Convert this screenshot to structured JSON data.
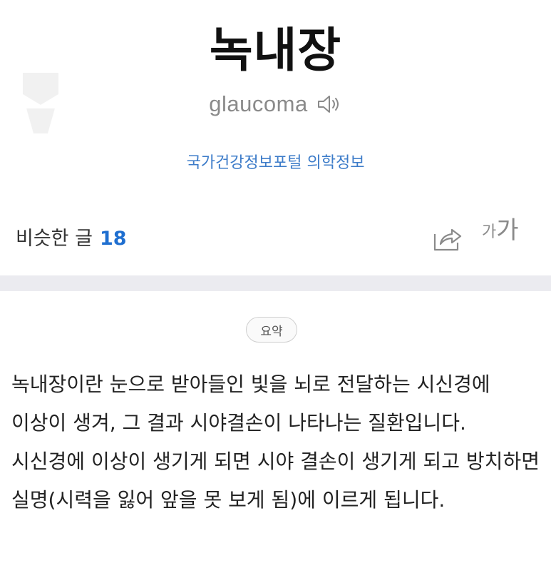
{
  "entry": {
    "title": "녹내장",
    "pronunciation": "glaucoma",
    "source": "국가건강정보포털 의학정보"
  },
  "toolbar": {
    "similar_label": "비슷한 글",
    "similar_count": "18",
    "font_small": "가",
    "font_large": "가"
  },
  "summary": {
    "badge": "요약",
    "text": "녹내장이란 눈으로 받아들인 빛을 뇌로 전달하는 시신경에 이상이 생겨, 그 결과 시야결손이 나타나는 질환입니다. 시신경에 이상이 생기게 되면 시야 결손이 생기게 되고 방치하면 실명(시력을 잃어 앞을 못 보게 됨)에 이르게 됩니다."
  },
  "icons": {
    "speaker": "speaker-icon",
    "share": "share-icon"
  },
  "colors": {
    "link": "#3d7cc9",
    "count": "#1f6fd0",
    "divider": "#ebebf0"
  }
}
